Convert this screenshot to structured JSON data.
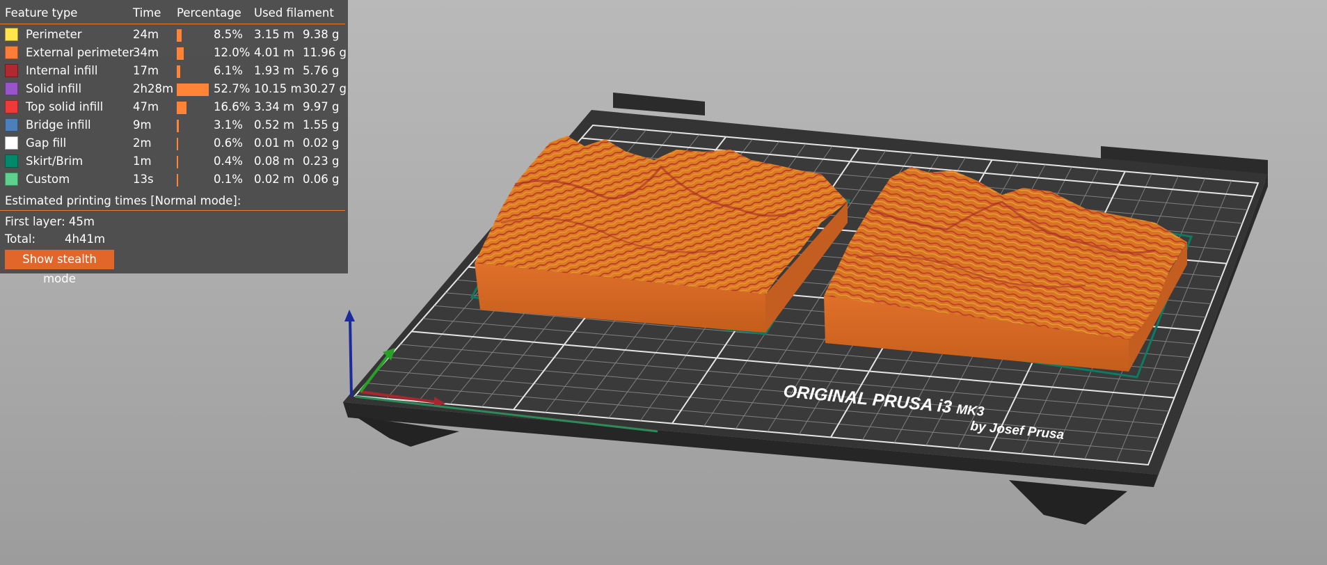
{
  "legend": {
    "columns": {
      "feature": "Feature type",
      "time": "Time",
      "percentage": "Percentage",
      "filament": "Used filament"
    },
    "rows": [
      {
        "name": "Perimeter",
        "time": "24m",
        "pct": "8.5%",
        "pct_value": 8.5,
        "length": "3.15 m",
        "weight": "9.38 g",
        "color": "#ffe64d"
      },
      {
        "name": "External perimeter",
        "time": "34m",
        "pct": "12.0%",
        "pct_value": 12.0,
        "length": "4.01 m",
        "weight": "11.96 g",
        "color": "#ff7d38"
      },
      {
        "name": "Internal infill",
        "time": "17m",
        "pct": "6.1%",
        "pct_value": 6.1,
        "length": "1.93 m",
        "weight": "5.76 g",
        "color": "#b02930"
      },
      {
        "name": "Solid infill",
        "time": "2h28m",
        "pct": "52.7%",
        "pct_value": 52.7,
        "length": "10.15 m",
        "weight": "30.27 g",
        "color": "#9954cc"
      },
      {
        "name": "Top solid infill",
        "time": "47m",
        "pct": "16.6%",
        "pct_value": 16.6,
        "length": "3.34 m",
        "weight": "9.97 g",
        "color": "#f03a3a"
      },
      {
        "name": "Bridge infill",
        "time": "9m",
        "pct": "3.1%",
        "pct_value": 3.1,
        "length": "0.52 m",
        "weight": "1.55 g",
        "color": "#4d80ba"
      },
      {
        "name": "Gap fill",
        "time": "2m",
        "pct": "0.6%",
        "pct_value": 0.6,
        "length": "0.01 m",
        "weight": "0.02 g",
        "color": "#ffffff"
      },
      {
        "name": "Skirt/Brim",
        "time": "1m",
        "pct": "0.4%",
        "pct_value": 0.4,
        "length": "0.08 m",
        "weight": "0.23 g",
        "color": "#008a6b"
      },
      {
        "name": "Custom",
        "time": "13s",
        "pct": "0.1%",
        "pct_value": 0.1,
        "length": "0.02 m",
        "weight": "0.06 g",
        "color": "#5ed18f"
      }
    ],
    "estimated_title": "Estimated printing times [Normal mode]:",
    "first_layer_label": "First layer: 45m",
    "total_label": "Total:",
    "total_value": "4h41m",
    "stealth_button": "Show stealth mode"
  },
  "bed": {
    "brand_line1": "ORIGINAL PRUSA i3",
    "brand_model": "MK3",
    "brand_line2": "by Josef Prusa"
  },
  "colors": {
    "accent": "#ee7a32",
    "panel_bg": "#464646",
    "model_orange": "#d9701f",
    "model_red": "#b02930"
  }
}
